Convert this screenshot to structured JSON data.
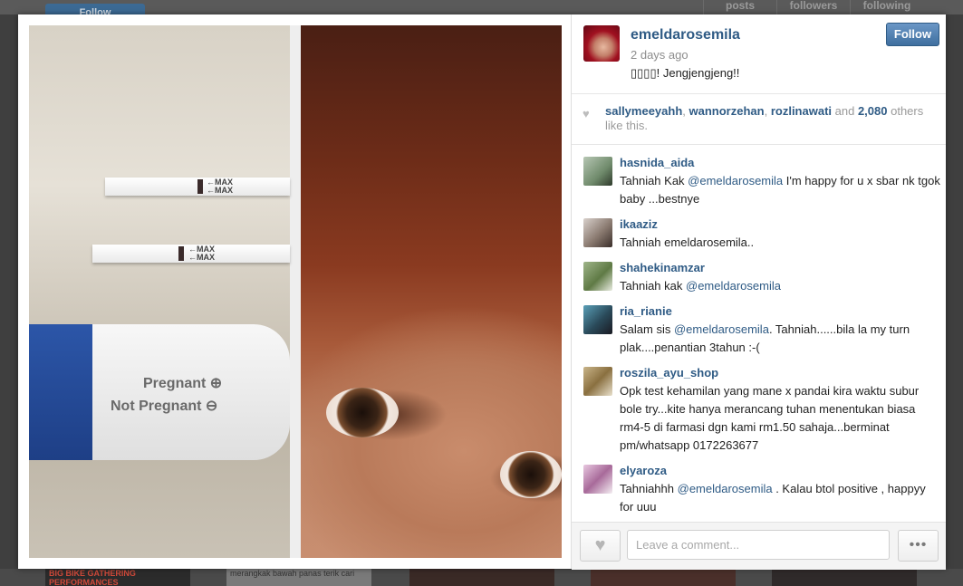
{
  "background": {
    "follow_label": "Follow",
    "stats": [
      "posts",
      "followers",
      "following"
    ],
    "thumb_texts": [
      "BIG BIKE GATHERING PERFORMANCES",
      "merangkak bawah panas terik cari"
    ]
  },
  "post": {
    "username": "emeldarosemila",
    "time": "2 days ago",
    "caption": "▯▯▯▯! Jengjengjeng!!",
    "follow_label": "Follow",
    "photo": {
      "strip1_label": "←MAX\n←MAX",
      "strip2_label": "←MAX\n←MAX",
      "label_pregnant": "Pregnant ⊕",
      "label_not_pregnant": "Not Pregnant ⊖"
    }
  },
  "likes": {
    "users": [
      "sallymeeyahh",
      "wannorzehan",
      "rozlinawati"
    ],
    "sep1": ", ",
    "sep2": ", ",
    "and_text": " and ",
    "count": "2,080",
    "others_text": " others like this."
  },
  "comments": [
    {
      "user": "hasnida_aida",
      "parts": [
        {
          "t": "Tahniah Kak "
        },
        {
          "t": "@emeldarosemila",
          "m": true
        },
        {
          "t": " I'm happy for u x sbar nk tgok baby ...bestnye"
        }
      ]
    },
    {
      "user": "ikaaziz",
      "parts": [
        {
          "t": "Tahniah emeldarosemila.."
        }
      ]
    },
    {
      "user": "shahekinamzar",
      "parts": [
        {
          "t": "Tahniah kak "
        },
        {
          "t": "@emeldarosemila",
          "m": true
        }
      ]
    },
    {
      "user": "ria_rianie",
      "parts": [
        {
          "t": "Salam sis "
        },
        {
          "t": "@emeldarosemila",
          "m": true
        },
        {
          "t": ". Tahniah......bila la my turn plak....penantian 3tahun :-("
        }
      ]
    },
    {
      "user": "roszila_ayu_shop",
      "parts": [
        {
          "t": "Opk test kehamilan yang mane x pandai kira waktu subur bole try...kite hanya merancang tuhan menentukan biasa rm4-5 di farmasi dgn kami rm1.50 sahaja...berminat pm/whatsapp 0172263677"
        }
      ]
    },
    {
      "user": "elyaroza",
      "parts": [
        {
          "t": "Tahniahhh "
        },
        {
          "t": "@emeldarosemila",
          "m": true
        },
        {
          "t": " . Kalau btol positive , happyy for uuu"
        }
      ]
    }
  ],
  "footer": {
    "like_icon": "heart-icon",
    "comment_placeholder": "Leave a comment...",
    "more_label": "•••"
  },
  "colors": {
    "link": "#2f5b85",
    "follow_button": "#4f80b2",
    "muted": "#8d8d8d"
  }
}
